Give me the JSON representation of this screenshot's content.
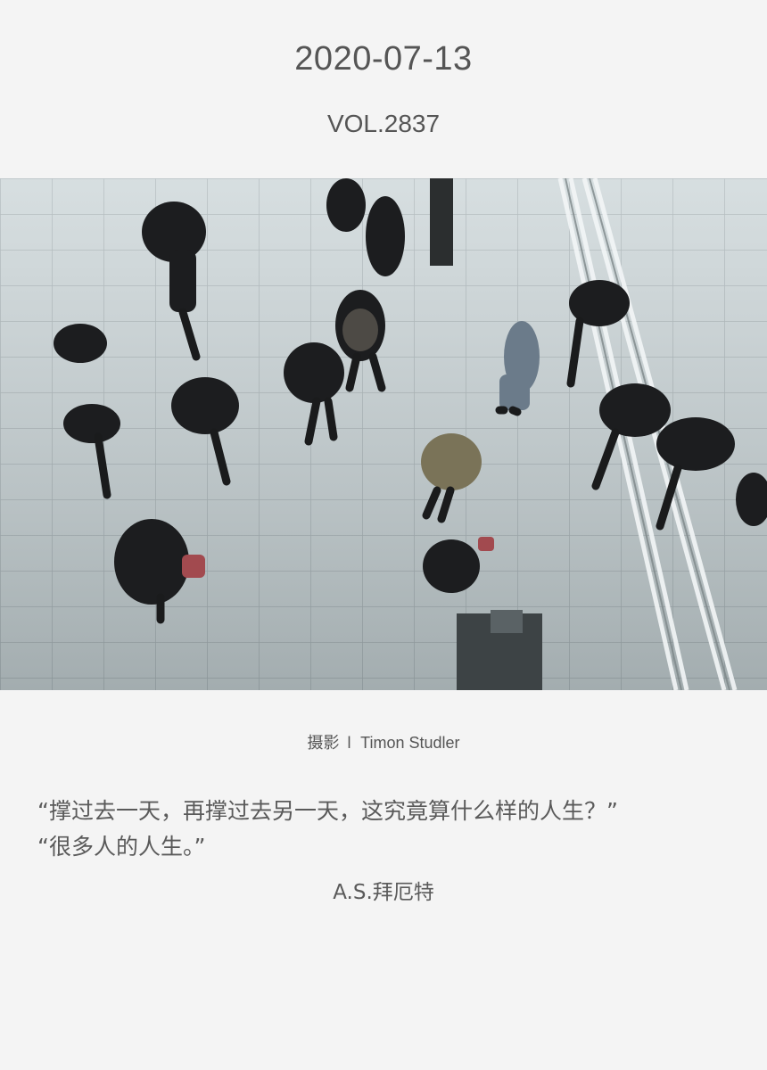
{
  "header": {
    "date": "2020-07-13",
    "volume": "VOL.2837"
  },
  "photo": {
    "subject": "crowd-walking-on-tiled-floor"
  },
  "credit": {
    "prefix": "摄影",
    "separator": "l",
    "photographer": "Timon Studler"
  },
  "quote": {
    "line1": "“撑过去一天，再撑过去另一天，这究竟算什么样的人生？”",
    "line2": "“很多人的人生。”",
    "author": "A.S.拜厄特"
  },
  "colors": {
    "background": "#f4f4f4",
    "text": "#555555"
  }
}
